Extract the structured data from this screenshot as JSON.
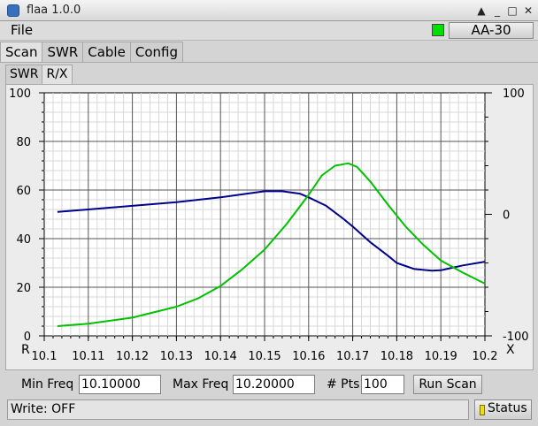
{
  "window": {
    "title": "flaa 1.0.0",
    "controls": [
      "▲",
      "_",
      "□",
      "✕"
    ]
  },
  "menu": {
    "file": "File"
  },
  "device": {
    "led_color": "#00e000",
    "button": "AA-30"
  },
  "tabs": [
    {
      "label": "Scan",
      "active": true
    },
    {
      "label": "SWR",
      "active": false
    },
    {
      "label": "Cable",
      "active": false
    },
    {
      "label": "Config",
      "active": false
    }
  ],
  "subtabs": [
    {
      "label": "SWR",
      "active": false
    },
    {
      "label": "R/X",
      "active": true
    }
  ],
  "chart_data": {
    "type": "line",
    "left_axis": {
      "label": "R",
      "ticks": [
        "0",
        "20",
        "40",
        "60",
        "80",
        "100"
      ],
      "range": [
        0,
        100
      ]
    },
    "right_axis": {
      "label": "",
      "ticks": [
        "-100",
        "0",
        "100"
      ],
      "range": [
        -100,
        100
      ]
    },
    "x_axis": {
      "label": "X",
      "ticks": [
        "10.1",
        "10.11",
        "10.12",
        "10.13",
        "10.14",
        "10.15",
        "10.16",
        "10.17",
        "10.18",
        "10.19",
        "10.2"
      ],
      "range": [
        10.1,
        10.2
      ]
    },
    "grid": true,
    "series": [
      {
        "color": "#00008b",
        "axis": "left",
        "x": [
          10.103,
          10.11,
          10.12,
          10.13,
          10.14,
          10.146,
          10.15,
          10.154,
          10.158,
          10.16,
          10.164,
          10.168,
          10.17,
          10.174,
          10.178,
          10.18,
          10.184,
          10.188,
          10.19,
          10.195,
          10.2
        ],
        "y": [
          51,
          52,
          53.5,
          55,
          57,
          58.5,
          59.5,
          59.5,
          58.5,
          57,
          53.5,
          48,
          45,
          38.5,
          33,
          30,
          27.5,
          26.8,
          27,
          29,
          30.5
        ]
      },
      {
        "color": "#00c000",
        "axis": "right",
        "x": [
          10.103,
          10.11,
          10.12,
          10.13,
          10.135,
          10.14,
          10.145,
          10.15,
          10.155,
          10.16,
          10.163,
          10.166,
          10.169,
          10.171,
          10.174,
          10.178,
          10.182,
          10.186,
          10.19,
          10.195,
          10.2
        ],
        "y": [
          -92,
          -90,
          -85,
          -76,
          -69,
          -59,
          -45,
          -29,
          -8,
          16,
          32,
          40,
          42,
          39,
          27,
          8,
          -10,
          -25,
          -38,
          -48,
          -57
        ]
      }
    ]
  },
  "controls": {
    "min_freq_label": "Min Freq",
    "min_freq_value": "10.10000",
    "max_freq_label": "Max Freq",
    "max_freq_value": "10.20000",
    "pts_label": "# Pts",
    "pts_value": "100",
    "run_scan": "Run Scan"
  },
  "status": {
    "text": "Write: OFF",
    "button": "Status",
    "led_color": "#f0e000"
  }
}
